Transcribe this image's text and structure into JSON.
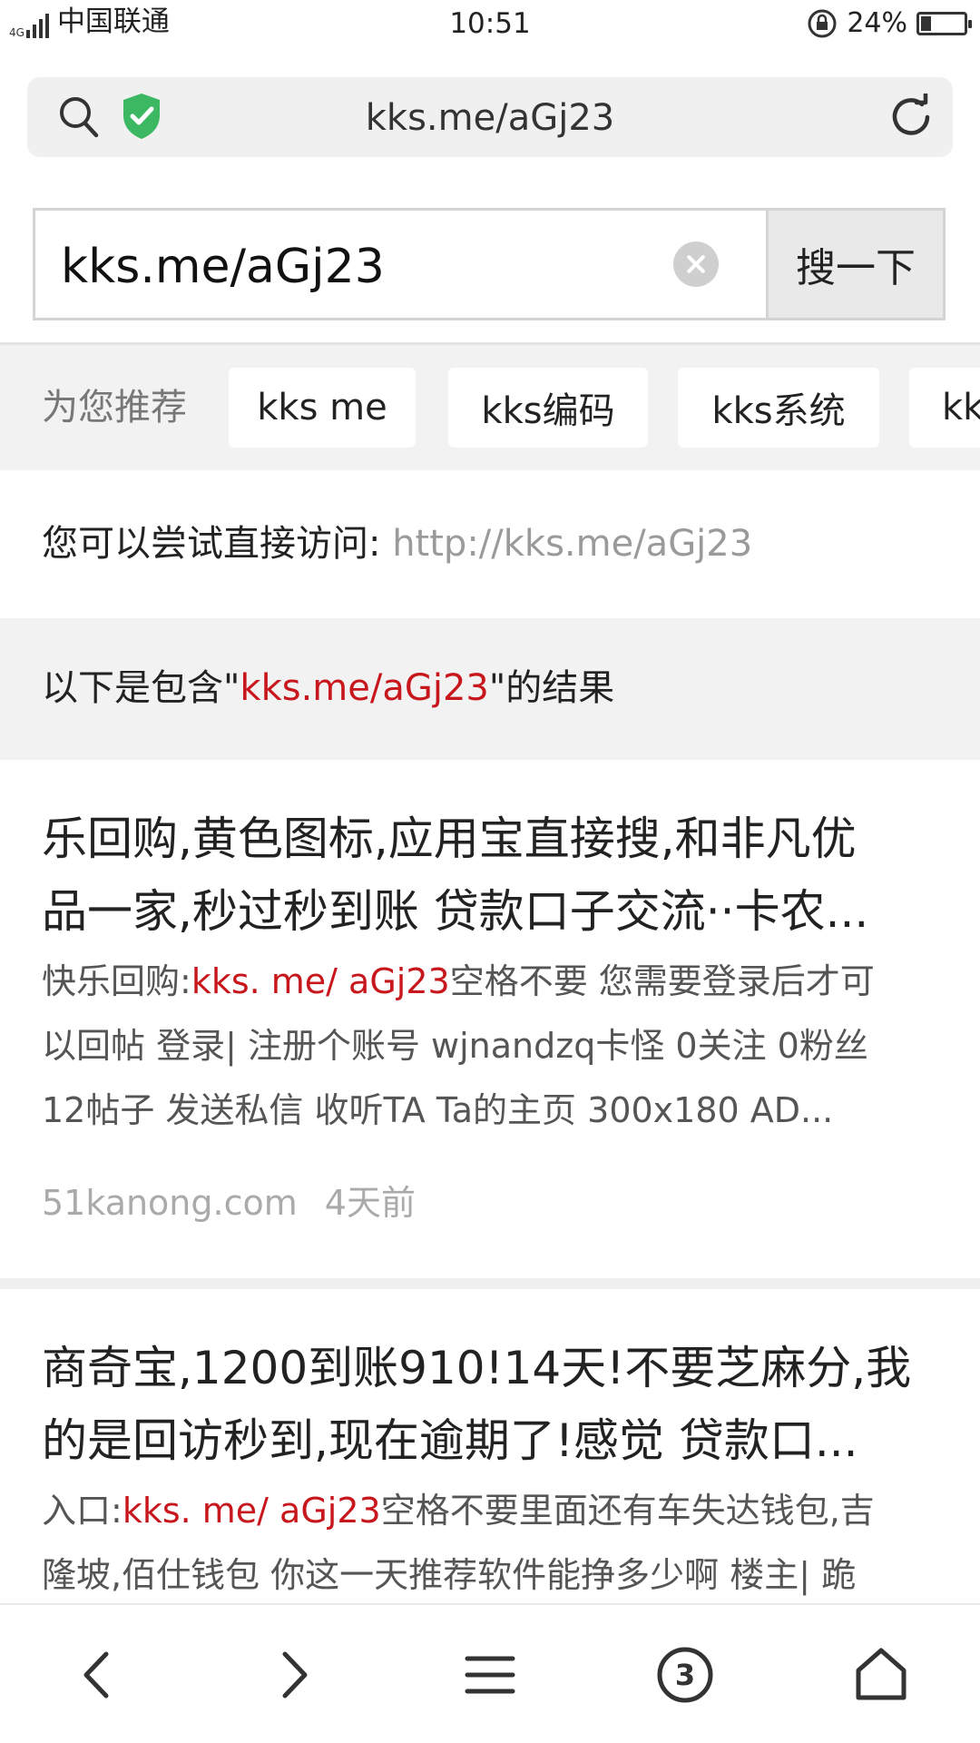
{
  "status_bar": {
    "network": "4G",
    "carrier": "中国联通",
    "time": "10:51",
    "battery": "24%",
    "battery_level": 0.24
  },
  "address_bar": {
    "url": "kks.me/aGj23"
  },
  "search": {
    "value": "kks.me/aGj23",
    "button": "搜一下"
  },
  "recommend": {
    "label": "为您推荐",
    "chips": [
      "kks me",
      "kks编码",
      "kks系统",
      "kk"
    ]
  },
  "direct_visit": {
    "label": "您可以尝试直接访问:",
    "link": "http://kks.me/aGj23"
  },
  "results_header": {
    "prefix": "以下是包含\"",
    "query": "kks.me/aGj23",
    "suffix": "\"的结果"
  },
  "results": [
    {
      "title_line1": "乐回购,黄色图标,应用宝直接搜,和非凡优",
      "title_line2": "品一家,秒过秒到账 贷款口子交流··卡农...",
      "snippet_prefix": "快乐回购:",
      "snippet_highlight": "kks. me/ aGj23",
      "snippet_line1_rest": "空格不要 您需要登录后才可",
      "snippet_line2": "以回帖 登录| 注册个账号 wjnandzq卡怪 0关注 0粉丝",
      "snippet_line3": "12帖子 发送私信 收听TA Ta的主页 300x180 AD...",
      "source": "51kanong.com",
      "time": "4天前"
    },
    {
      "title_line1": "商奇宝,1200到账910!14天!不要芝麻分,我",
      "title_line2": "的是回访秒到,现在逾期了!感觉 贷款口...",
      "snippet_prefix": "入口:",
      "snippet_highlight": "kks. me/ aGj23",
      "snippet_line1_rest": "空格不要里面还有车失达钱包,吉",
      "snippet_line2": "隆坡,佰仕钱包 你这一天推荐软件能挣多少啊 楼主| 跪"
    }
  ],
  "bottom_nav": {
    "tab_count": "3"
  }
}
